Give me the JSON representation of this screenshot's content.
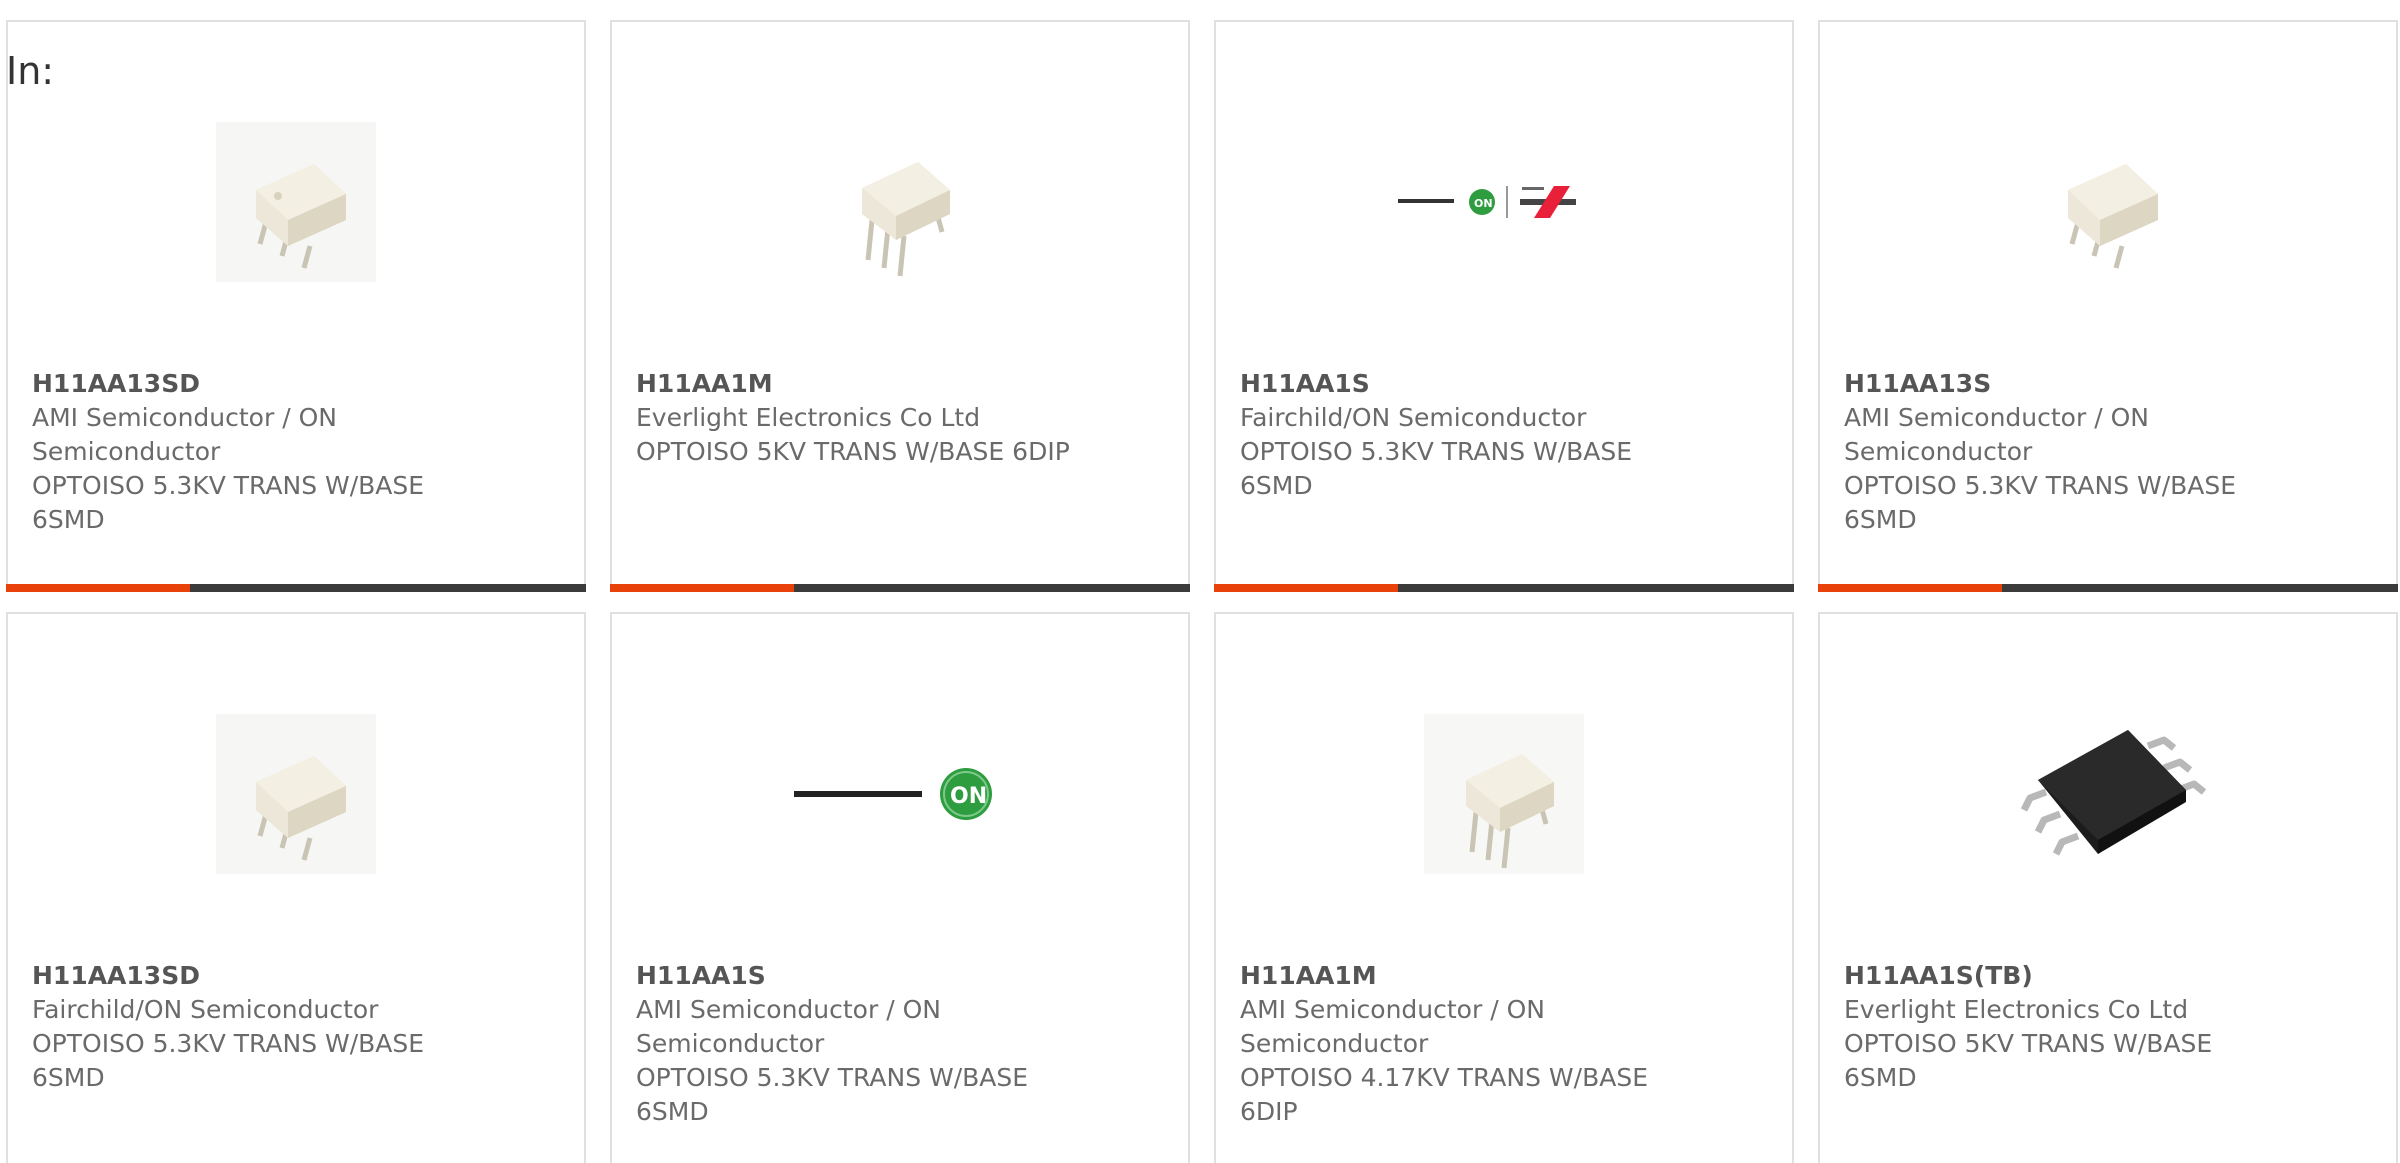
{
  "page": {
    "heading": "In:"
  },
  "colors": {
    "accent": "#e8420a",
    "bar": "#3b3b3b",
    "border": "#e0e0e0",
    "text": "#6a6a6a"
  },
  "products": [
    {
      "part": "H11AA13SD",
      "manufacturer": "AMI Semiconductor / ON Semiconductor",
      "description": "OPTOISO 5.3KV TRANS W/BASE 6SMD",
      "image": "smd-chip-icon"
    },
    {
      "part": "H11AA1M",
      "manufacturer": "Everlight Electronics Co Ltd",
      "description": "OPTOISO 5KV TRANS W/BASE 6DIP",
      "image": "dip-chip-icon"
    },
    {
      "part": "H11AA1S",
      "manufacturer": "Fairchild/ON Semiconductor",
      "description": "OPTOISO 5.3KV TRANS W/BASE 6SMD",
      "image": "fairchild-logo"
    },
    {
      "part": "H11AA13S",
      "manufacturer": "AMI Semiconductor / ON Semiconductor",
      "description": "OPTOISO 5.3KV TRANS W/BASE 6SMD",
      "image": "smd-chip-icon"
    },
    {
      "part": "H11AA13SD",
      "manufacturer": "Fairchild/ON Semiconductor",
      "description": "OPTOISO 5.3KV TRANS W/BASE 6SMD",
      "image": "smd-chip-icon"
    },
    {
      "part": "H11AA1S",
      "manufacturer": "AMI Semiconductor / ON Semiconductor",
      "description": "OPTOISO 5.3KV TRANS W/BASE 6SMD",
      "image": "on-semi-logo"
    },
    {
      "part": "H11AA1M",
      "manufacturer": "AMI Semiconductor / ON Semiconductor",
      "description": "OPTOISO 4.17KV TRANS W/BASE 6DIP",
      "image": "dip-chip-icon"
    },
    {
      "part": "H11AA1S(TB)",
      "manufacturer": "Everlight Electronics Co Ltd",
      "description": "OPTOISO 5KV TRANS W/BASE 6SMD",
      "image": "black-smd-chip-icon"
    }
  ]
}
